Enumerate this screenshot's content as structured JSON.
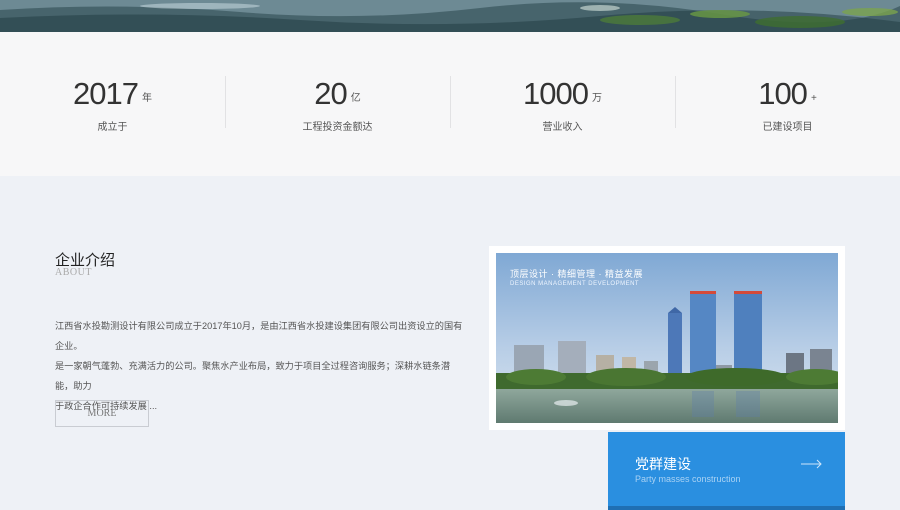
{
  "stats": [
    {
      "number": "2017",
      "unit": "年",
      "label": "成立于"
    },
    {
      "number": "20",
      "unit": "亿",
      "label": "工程投资金额达"
    },
    {
      "number": "1000",
      "unit": "万",
      "label": "营业收入"
    },
    {
      "number": "100",
      "unit": "+",
      "label": "已建设项目"
    }
  ],
  "intro": {
    "title": "企业介绍",
    "subtitle": "ABOUT",
    "lines": [
      "江西省水投勘测设计有限公司成立于2017年10月，是由江西省水投建设集团有限公司出资设立的国有企业。",
      "是一家朝气蓬勃、充满活力的公司。聚焦水产业布局，致力于项目全过程咨询服务；深耕水链条潜能，助力",
      "于政企合作可持续发展 ..."
    ],
    "more_label": "MORE"
  },
  "photo": {
    "caption": "顶层设计 · 精细管理 · 精益发展",
    "caption_en": "DESIGN MANAGEMENT DEVELOPMENT"
  },
  "party": {
    "title": "党群建设",
    "subtitle": "Party masses construction"
  },
  "colors": {
    "accent": "#2a8fe0",
    "stats_bg": "#f7f7f8",
    "section_bg": "#eef1f6"
  }
}
